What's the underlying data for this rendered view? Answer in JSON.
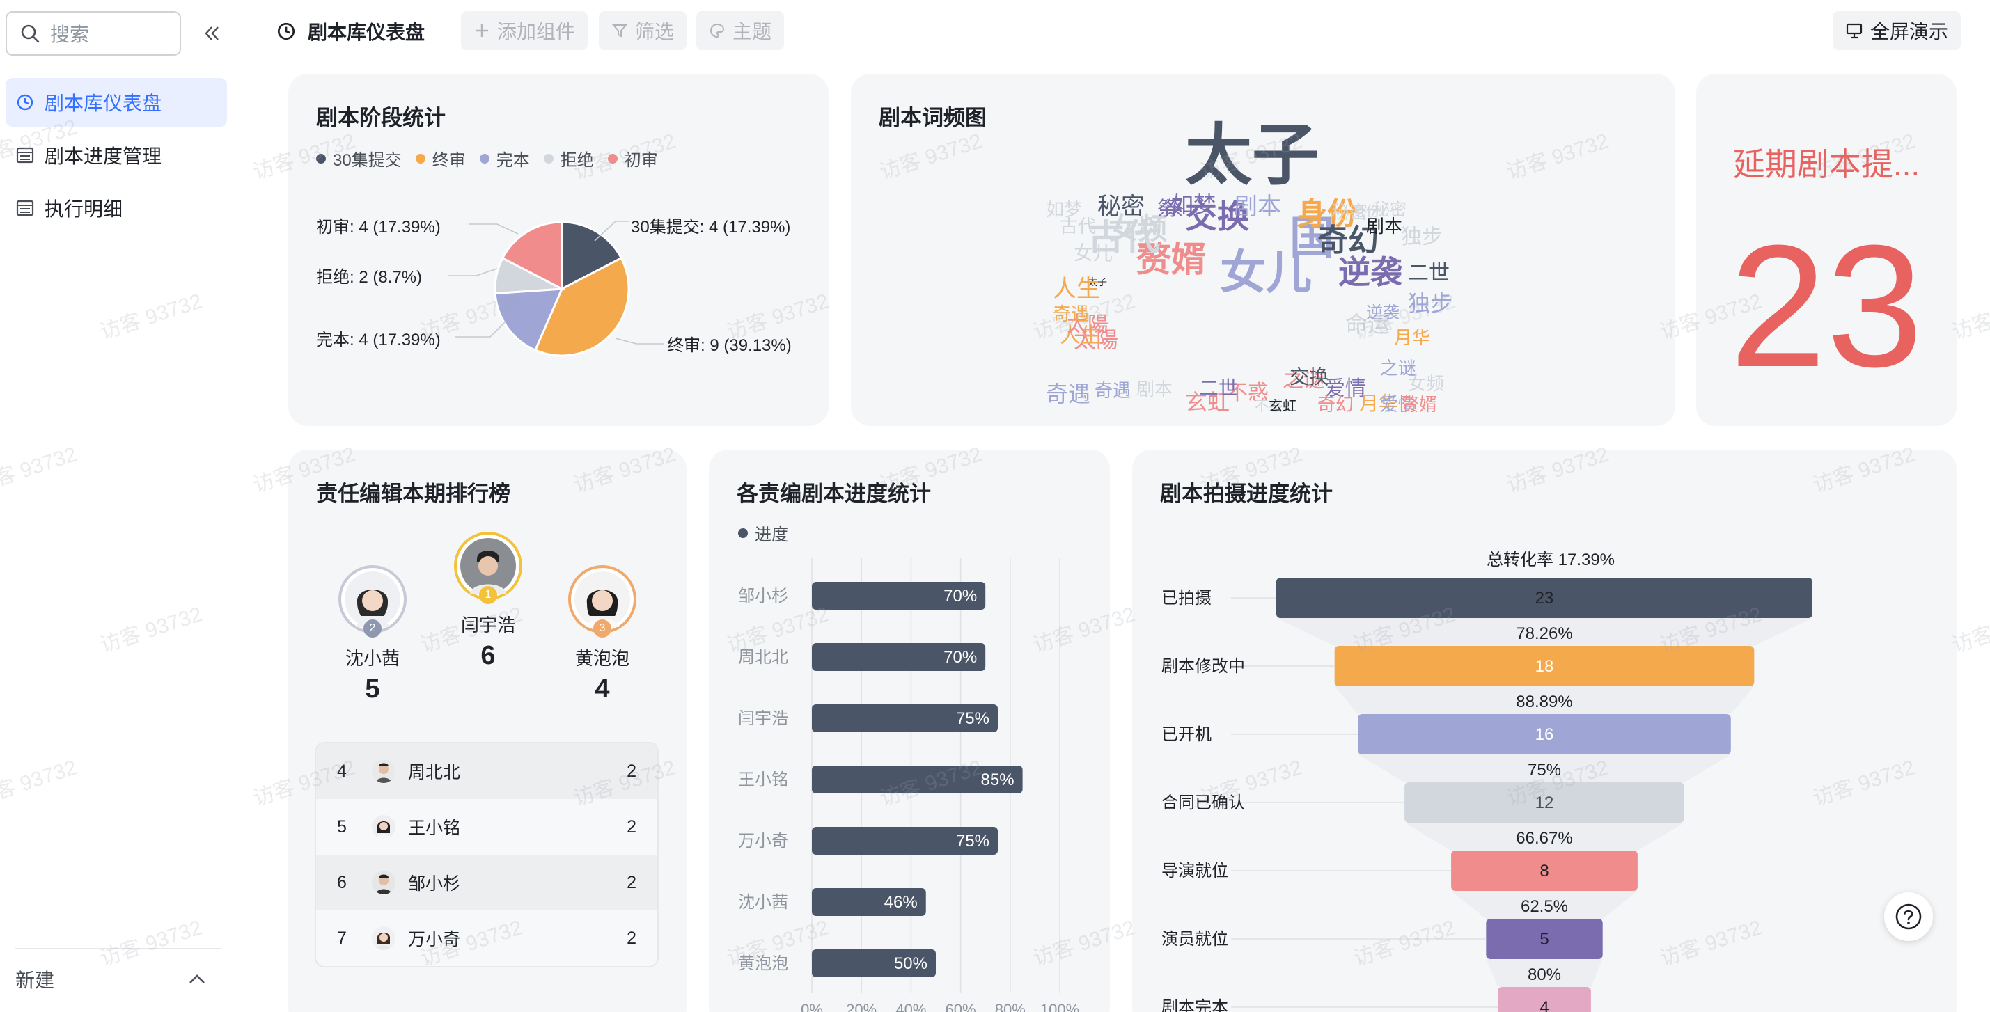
{
  "sidebar": {
    "search_placeholder": "搜索",
    "items": [
      {
        "label": "剧本库仪表盘",
        "icon": "dashboard-icon",
        "active": true
      },
      {
        "label": "剧本进度管理",
        "icon": "table-icon",
        "active": false
      },
      {
        "label": "执行明细",
        "icon": "table-icon",
        "active": false
      }
    ],
    "new_label": "新建"
  },
  "toolbar": {
    "title": "剧本库仪表盘",
    "add_component": "添加组件",
    "filter": "筛选",
    "theme": "主题",
    "fullscreen": "全屏演示"
  },
  "stage_card": {
    "title": "剧本阶段统计",
    "legend": [
      "30集提交",
      "终审",
      "完本",
      "拒绝",
      "初审"
    ],
    "labels": [
      "30集提交: 4 (17.39%)",
      "终审: 9 (39.13%)",
      "完本: 4 (17.39%)",
      "拒绝: 2 (8.7%)",
      "初审: 4 (17.39%)"
    ],
    "chart_data": {
      "type": "pie",
      "slices": [
        {
          "name": "30集提交",
          "value": 4,
          "color": "#4a5568"
        },
        {
          "name": "终审",
          "value": 9,
          "color": "#f5a94d"
        },
        {
          "name": "完本",
          "value": 4,
          "color": "#9fa6d6"
        },
        {
          "name": "拒绝",
          "value": 2,
          "color": "#d2d7de"
        },
        {
          "name": "初审",
          "value": 4,
          "color": "#f08c8c"
        }
      ]
    }
  },
  "wordcloud_card": {
    "title": "剧本词频图",
    "words": [
      "太子",
      "女儿",
      "国",
      "赘婿",
      "交换",
      "身份",
      "奇幻",
      "逆袭",
      "古代",
      "女频",
      "秘密",
      "如梦",
      "剧本",
      "二世",
      "不惑",
      "太陽",
      "人生",
      "奇遇",
      "之谜",
      "爱情",
      "玄虹",
      "月华",
      "命运",
      "独步",
      "祭",
      "秘密",
      "如梦",
      "太子",
      "秘密",
      "剧本",
      "奇遇",
      "二世",
      "不惑",
      "交换",
      "之谜",
      "月华",
      "爱情",
      "玄虹",
      "奇幻",
      "逆袭",
      "赘婿",
      "太陽",
      "古代",
      "女儿",
      "身份",
      "奇遇",
      "剧本",
      "独步",
      "女频",
      "人生",
      "祭"
    ]
  },
  "kpi_card": {
    "label": "延期剧本提...",
    "value": "23"
  },
  "ranking_card": {
    "title": "责任编辑本期排行榜",
    "podium": [
      {
        "rank": "2",
        "name": "沈小茜",
        "score": "5"
      },
      {
        "rank": "1",
        "name": "闫宇浩",
        "score": "6"
      },
      {
        "rank": "3",
        "name": "黄泡泡",
        "score": "4"
      }
    ],
    "list": [
      {
        "rank": "4",
        "name": "周北北",
        "score": "2"
      },
      {
        "rank": "5",
        "name": "王小铭",
        "score": "2"
      },
      {
        "rank": "6",
        "name": "邹小杉",
        "score": "2"
      },
      {
        "rank": "7",
        "name": "万小奇",
        "score": "2"
      }
    ]
  },
  "progress_card": {
    "title": "各责编剧本进度统计",
    "legend": "进度",
    "axis_ticks": [
      "0%",
      "20%",
      "40%",
      "60%",
      "80%",
      "100%"
    ],
    "chart_data": {
      "type": "bar",
      "orientation": "horizontal",
      "categories": [
        "邹小杉",
        "周北北",
        "闫宇浩",
        "王小铭",
        "万小奇",
        "沈小茜",
        "黄泡泡"
      ],
      "values": [
        70,
        70,
        75,
        85,
        75,
        46,
        50
      ],
      "value_labels": [
        "70%",
        "70%",
        "75%",
        "85%",
        "75%",
        "46%",
        "50%"
      ],
      "series_name": "进度",
      "xlim": [
        0,
        100
      ],
      "color": "#4a5568"
    }
  },
  "funnel_card": {
    "title": "剧本拍摄进度统计",
    "total_rate": "总转化率 17.39%",
    "chart_data": {
      "type": "funnel",
      "stages": [
        {
          "name": "已拍摄",
          "value": 23,
          "color": "#4a5568",
          "text_color": "#1f2329"
        },
        {
          "name": "剧本修改中",
          "value": 18,
          "color": "#f5a94d",
          "text_color": "#ffffff"
        },
        {
          "name": "已开机",
          "value": 16,
          "color": "#9fa6d6",
          "text_color": "#ffffff"
        },
        {
          "name": "合同已确认",
          "value": 12,
          "color": "#d2d7de",
          "text_color": "#4a4f57"
        },
        {
          "name": "导演就位",
          "value": 8,
          "color": "#f08c8c",
          "text_color": "#1f2329"
        },
        {
          "name": "演员就位",
          "value": 5,
          "color": "#7b6cb0",
          "text_color": "#1f2329"
        },
        {
          "name": "剧本完本",
          "value": 4,
          "color": "#e3a8c4",
          "text_color": "#1f2329"
        }
      ],
      "rates": [
        "78.26%",
        "88.89%",
        "75%",
        "66.67%",
        "62.5%",
        "80%"
      ]
    }
  },
  "watermark": "访客 93732"
}
